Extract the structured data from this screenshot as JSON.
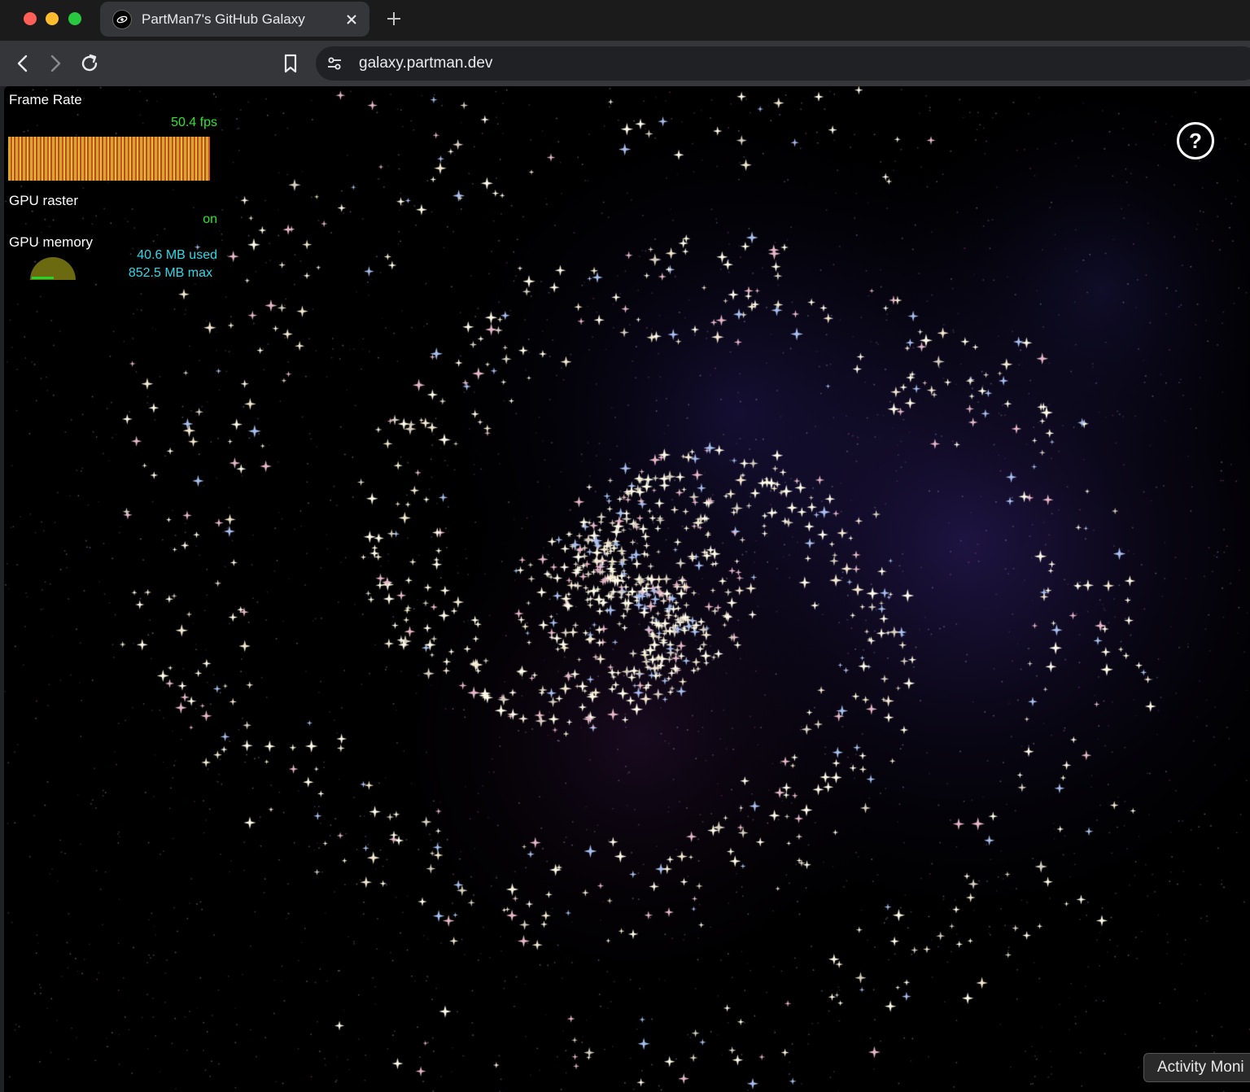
{
  "browser": {
    "tab_title": "PartMan7's GitHub Galaxy",
    "url": "galaxy.partman.dev",
    "icons": {
      "close_window": "red-traffic-light",
      "minimize": "yellow-traffic-light",
      "maximize": "green-traffic-light",
      "favicon": "galaxy-spiral-icon",
      "tab_close": "close-icon",
      "new_tab": "plus-icon",
      "back": "arrow-left-icon",
      "forward": "arrow-right-icon",
      "reload": "reload-icon",
      "bookmark": "bookmark-icon",
      "site_info": "tune-sliders-icon"
    }
  },
  "hud": {
    "frame_rate_label": "Frame Rate",
    "frame_rate_value": "50.4 fps",
    "gpu_raster_label": "GPU raster",
    "gpu_raster_value": "on",
    "gpu_memory_label": "GPU memory",
    "gpu_memory_used": "40.6 MB used",
    "gpu_memory_max": "852.5 MB max",
    "colors": {
      "fps_value": "#2ee52e",
      "raster_value": "#2ee52e",
      "memory_value": "#2fd8e8"
    }
  },
  "page": {
    "help_label": "?"
  },
  "system": {
    "tooltip": "Activity Moni"
  }
}
